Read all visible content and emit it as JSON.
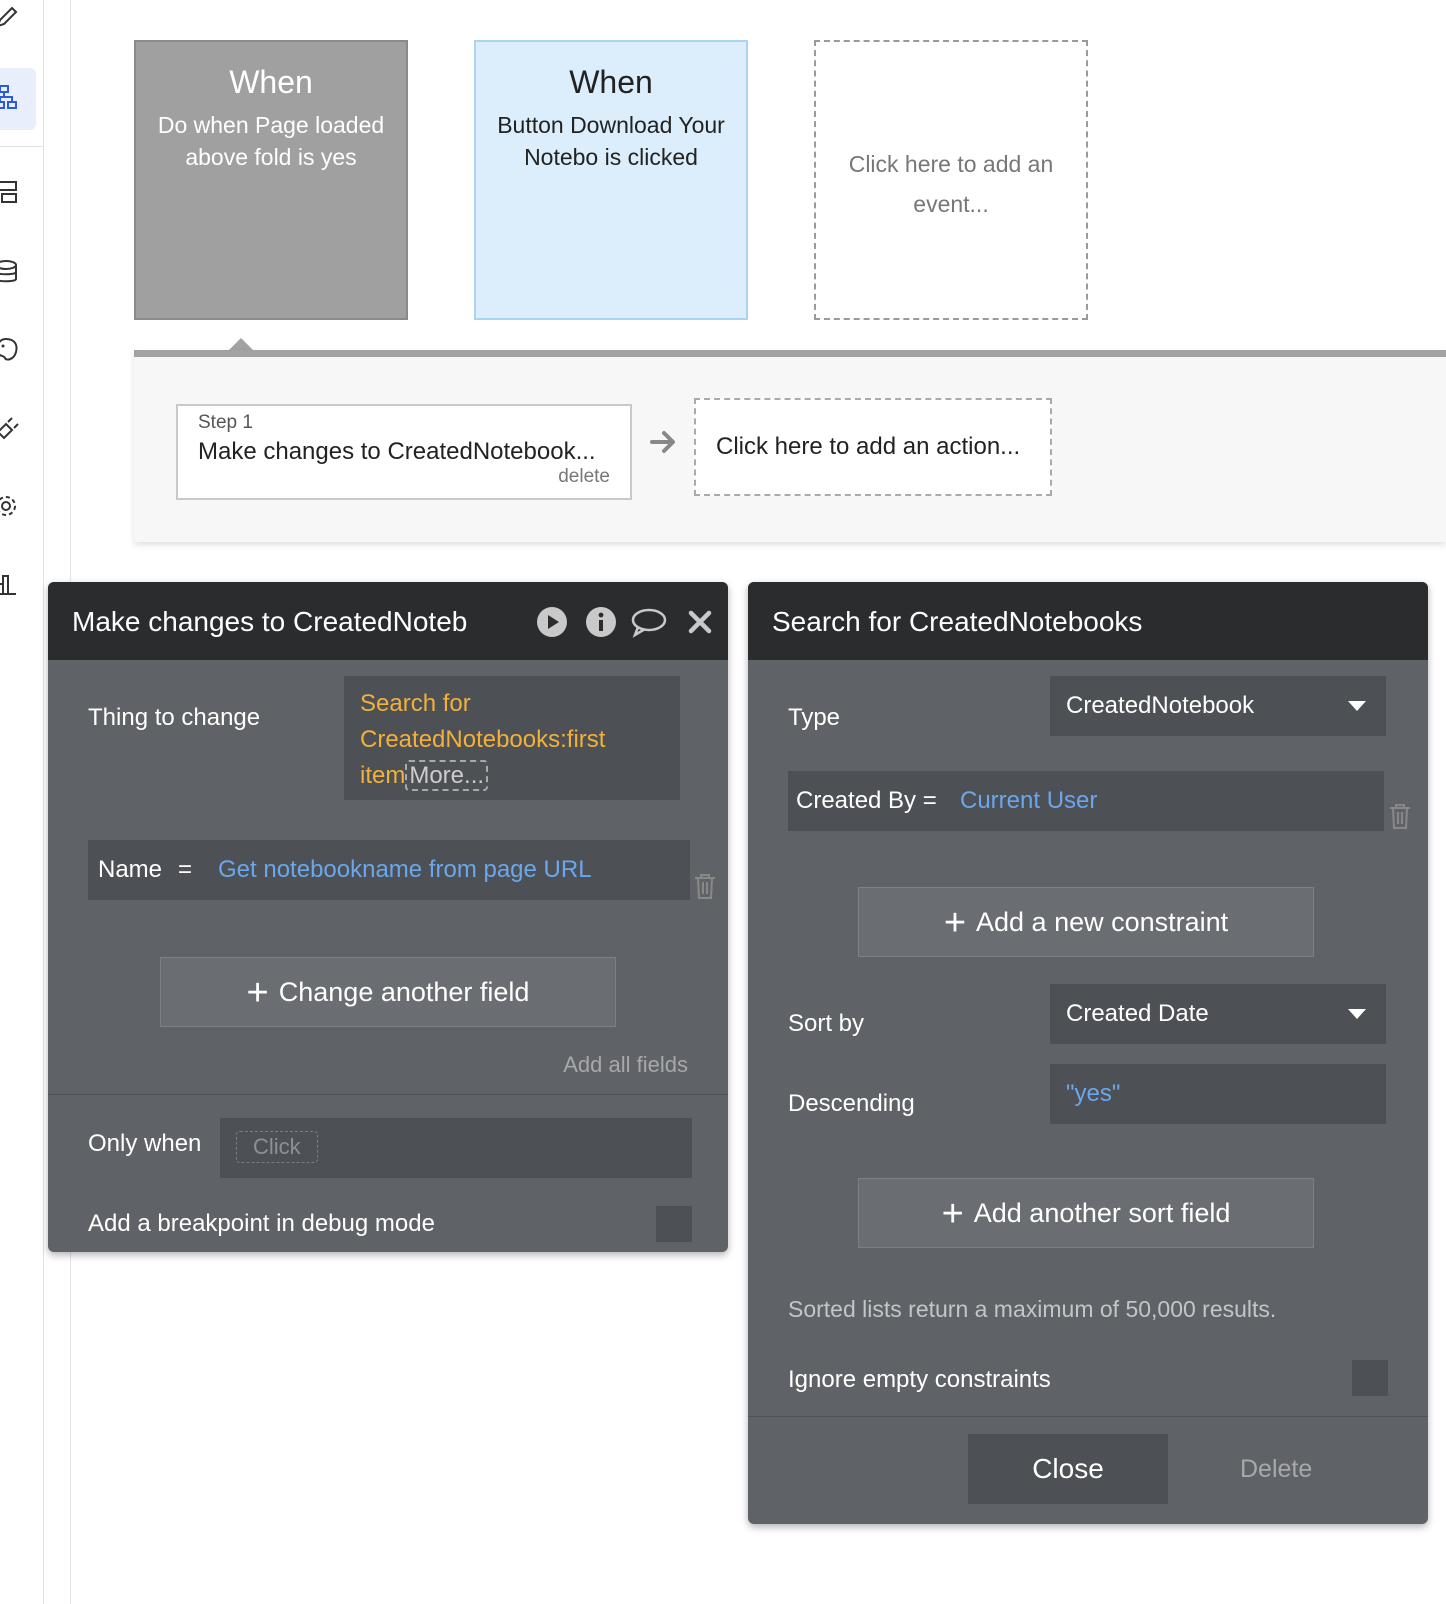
{
  "events": [
    {
      "title": "When",
      "subtitle": "Do when Page loaded above fold is yes"
    },
    {
      "title": "When",
      "subtitle": "Button Download Your Notebo is clicked"
    },
    {
      "placeholder": "Click here to add an event..."
    }
  ],
  "workflow": {
    "step_label": "Step 1",
    "step_text": "Make changes to CreatedNotebook...",
    "step_delete": "delete",
    "add_action": "Click here to add an action..."
  },
  "make_changes_panel": {
    "title": "Make changes to CreatedNoteb",
    "thing_label": "Thing to change",
    "thing_value_1": "Search for",
    "thing_value_2": "CreatedNotebooks:first",
    "thing_value_3": "item",
    "thing_more": "More...",
    "field_name": "Name",
    "field_eq": "=",
    "field_value": "Get notebookname from page URL",
    "change_another": "Change another field",
    "add_all_fields": "Add all fields",
    "only_when_label": "Only when",
    "only_when_placeholder": "Click",
    "breakpoint_label": "Add a breakpoint in debug mode"
  },
  "search_panel": {
    "title": "Search for CreatedNotebooks",
    "type_label": "Type",
    "type_value": "CreatedNotebook",
    "constraint_label": "Created By =",
    "constraint_value": "Current User",
    "add_constraint": "Add a new constraint",
    "sort_label": "Sort by",
    "sort_value": "Created Date",
    "desc_label": "Descending",
    "desc_value": "\"yes\"",
    "add_sort": "Add another sort field",
    "sort_note": "Sorted lists return a maximum of 50,000 results.",
    "ignore_label": "Ignore empty constraints",
    "close_label": "Close",
    "delete_label": "Delete"
  },
  "colors": {
    "accent_blue": "#6aa7ec",
    "accent_yellow": "#f1b13a",
    "panel_bg": "#5f6266",
    "header_bg": "#2a2c2e"
  }
}
